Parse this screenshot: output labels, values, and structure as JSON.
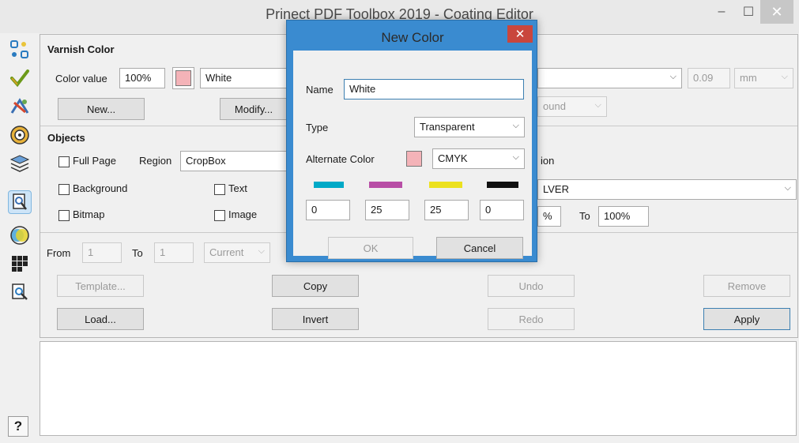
{
  "window": {
    "title": "Prinect PDF Toolbox 2019 - Coating Editor",
    "minimize_glyph": "–",
    "maximize_glyph": "☐",
    "close_glyph": "✕"
  },
  "toolbar": {
    "icons": [
      "flow-icon",
      "check-icon",
      "route-icon",
      "target-icon",
      "layers-icon",
      "coating-icon",
      "venn-icon",
      "grid-icon",
      "zoom-page-icon"
    ],
    "help_label": "?"
  },
  "varnish": {
    "section_title": "Varnish Color",
    "color_value_label": "Color value",
    "color_value": "100%",
    "color_name": "White",
    "swatch_color": "#f4b3b8",
    "new_label": "New...",
    "modify_label": "Modify...",
    "thickness_value": "0.09",
    "unit": "mm",
    "round_partial": "ound"
  },
  "objects": {
    "section_title": "Objects",
    "full_page_label": "Full Page",
    "region_label": "Region",
    "region_value": "CropBox",
    "position_partial": "ion",
    "background_label": "Background",
    "text_label": "Text",
    "bitmap_label": "Bitmap",
    "image_label": "Image",
    "silver_partial": "LVER",
    "percent_partial": "%",
    "to_label": "To",
    "to_value": "100%"
  },
  "pages": {
    "from_label": "From",
    "from_value": "1",
    "to_label": "To",
    "to_value": "1",
    "scope": "Current"
  },
  "actions": {
    "template": "Template...",
    "load": "Load...",
    "copy": "Copy",
    "invert": "Invert",
    "undo": "Undo",
    "redo": "Redo",
    "remove": "Remove",
    "apply": "Apply"
  },
  "dialog": {
    "title": "New Color",
    "close_glyph": "✕",
    "name_label": "Name",
    "name_value": "White",
    "type_label": "Type",
    "type_value": "Transparent",
    "alternate_label": "Alternate Color",
    "alternate_value": "CMYK",
    "swatch_color": "#f4b3b8",
    "inks": [
      {
        "name": "cyan",
        "color": "#00a9c7",
        "value": "0"
      },
      {
        "name": "magenta",
        "color": "#b84ea6",
        "value": "25"
      },
      {
        "name": "yellow",
        "color": "#ece11e",
        "value": "25"
      },
      {
        "name": "black",
        "color": "#111111",
        "value": "0"
      }
    ],
    "ok_label": "OK",
    "cancel_label": "Cancel"
  }
}
